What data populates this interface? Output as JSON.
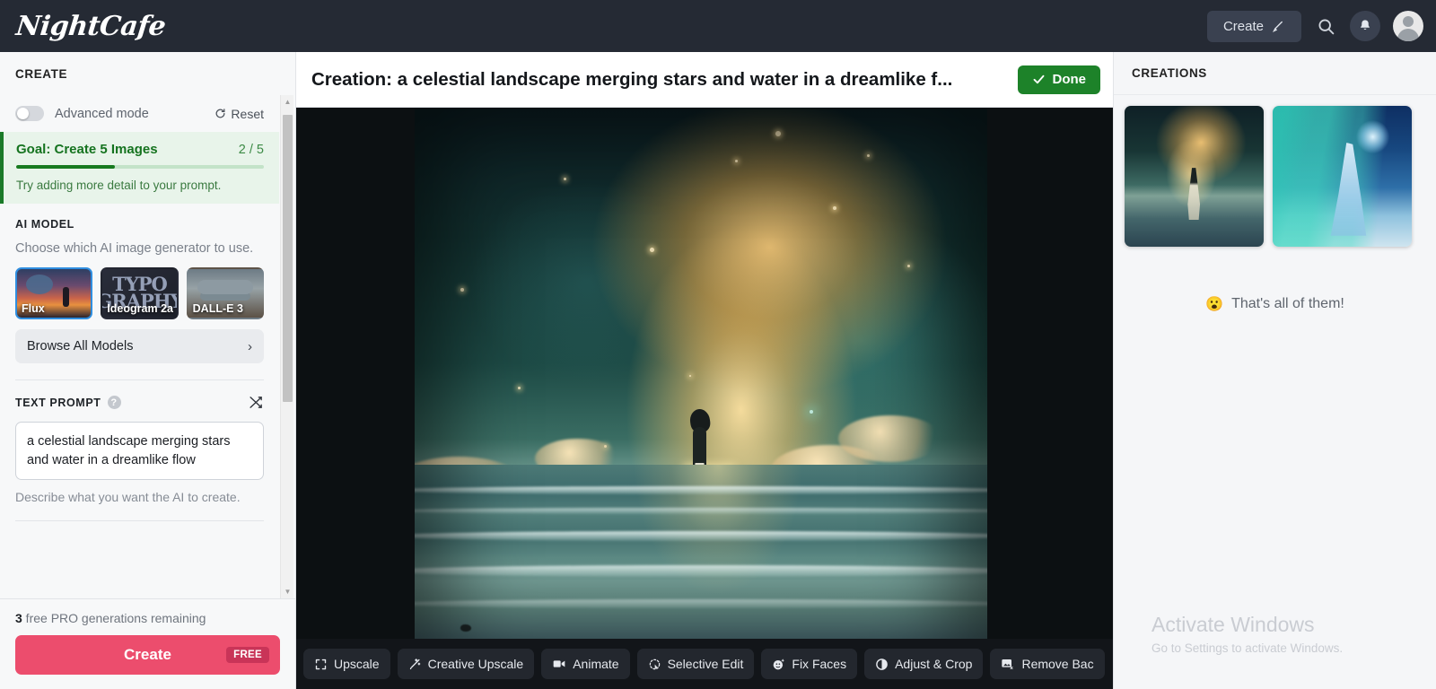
{
  "topnav": {
    "brand": "NightCafe",
    "create_button": "Create",
    "icons": {
      "brush": "brush-icon",
      "search": "search-icon",
      "bell": "bell-icon",
      "avatar": "avatar-icon"
    }
  },
  "sidebar": {
    "header": "CREATE",
    "advanced_mode_label": "Advanced mode",
    "advanced_mode_on": false,
    "reset_label": "Reset",
    "goal": {
      "title": "Goal: Create 5 Images",
      "count": "2 / 5",
      "progress_percent": 40,
      "hint": "Try adding more detail to your prompt."
    },
    "ai_model": {
      "label": "AI MODEL",
      "description": "Choose which AI image generator to use.",
      "models": [
        {
          "name": "Flux",
          "selected": true
        },
        {
          "name": "Ideogram 2a",
          "selected": false
        },
        {
          "name": "DALL-E 3",
          "selected": false
        }
      ],
      "ideogram_art_text": "TYPO\nGRAPHY",
      "browse_label": "Browse All Models"
    },
    "text_prompt": {
      "label": "TEXT PROMPT",
      "help": "?",
      "value": "a celestial landscape merging stars and water in a dreamlike flow",
      "placeholder": "Describe what you want the AI to create.",
      "description": "Describe what you want the AI to create."
    },
    "footer": {
      "free_count": "3",
      "free_text": " free PRO generations remaining",
      "create_label": "Create",
      "free_badge": "FREE"
    }
  },
  "center": {
    "title": "Creation: a celestial landscape merging stars and water in a dreamlike f...",
    "done_label": "Done",
    "toolbar": [
      {
        "label": "Upscale",
        "icon": "expand-arrows-icon"
      },
      {
        "label": "Creative Upscale",
        "icon": "magic-wand-icon"
      },
      {
        "label": "Animate",
        "icon": "video-camera-icon"
      },
      {
        "label": "Selective Edit",
        "icon": "dashed-circle-cursor-icon"
      },
      {
        "label": "Fix Faces",
        "icon": "face-sparkle-icon"
      },
      {
        "label": "Adjust & Crop",
        "icon": "contrast-icon"
      },
      {
        "label": "Remove Bac",
        "icon": "image-remove-icon"
      }
    ]
  },
  "right": {
    "header": "CREATIONS",
    "thumbnails": [
      {
        "alt": "celestial figure over glowing sea"
      },
      {
        "alt": "ethereal woman holding moon under aurora"
      }
    ],
    "end_message": "That's all of them!",
    "end_emoji": "😮"
  },
  "watermark": {
    "line1": "Activate Windows",
    "line2": "Go to Settings to activate Windows."
  },
  "colors": {
    "nav_bg": "#252a34",
    "accent_pink": "#ec4d6d",
    "done_green": "#1d8229",
    "goal_green": "#177a1f",
    "select_blue": "#2f8ee0"
  }
}
